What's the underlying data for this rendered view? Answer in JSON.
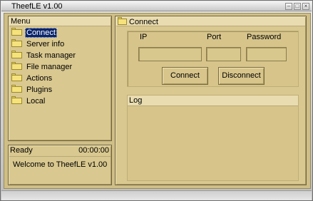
{
  "window": {
    "title": "TheefLE v1.00",
    "controls": [
      "minimize",
      "maximize",
      "close"
    ]
  },
  "menu": {
    "header": "Menu",
    "items": [
      {
        "label": "Connect",
        "icon": "folder-icon",
        "selected": true
      },
      {
        "label": "Server info",
        "icon": "folder-icon"
      },
      {
        "label": "Task manager",
        "icon": "folder-icon"
      },
      {
        "label": "File manager",
        "icon": "folder-icon"
      },
      {
        "label": "Actions",
        "icon": "folder-icon"
      },
      {
        "label": "Plugins",
        "icon": "folder-icon"
      },
      {
        "label": "Local",
        "icon": "folder-icon"
      }
    ]
  },
  "status": {
    "state": "Ready",
    "timer": "00:00:00",
    "message": "Welcome to TheefLE v1.00"
  },
  "connect": {
    "title": "Connect",
    "fields": {
      "ip_label": "IP",
      "port_label": "Port",
      "password_label": "Password",
      "ip_value": "",
      "port_value": "",
      "password_value": ""
    },
    "connect_button": "Connect",
    "disconnect_button": "Disconnect"
  },
  "log": {
    "header": "Log",
    "content": ""
  },
  "colors": {
    "panel": "#d9c88f",
    "header": "#e9dcb0",
    "selection": "#0a246a",
    "folder": "#f6e27c"
  }
}
